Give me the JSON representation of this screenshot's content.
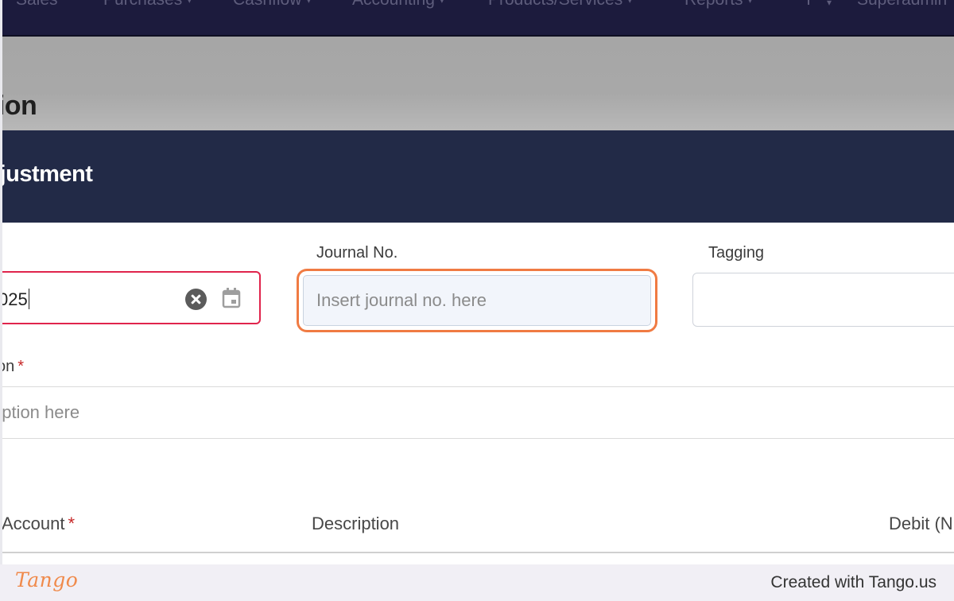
{
  "nav": {
    "items": [
      {
        "label": "Sales"
      },
      {
        "label": "Purchases"
      },
      {
        "label": "Cashflow"
      },
      {
        "label": "Accounting"
      },
      {
        "label": "Products/Services"
      },
      {
        "label": "Reports"
      },
      {
        "label": "Superadmin"
      }
    ]
  },
  "page": {
    "title": "tion"
  },
  "modal": {
    "title": "ljustment",
    "date": {
      "value": "025"
    },
    "journal": {
      "label": "Journal No.",
      "placeholder": "Insert journal no. here"
    },
    "tagging": {
      "label": "Tagging"
    },
    "description": {
      "label": "on",
      "required_mark": "*",
      "placeholder": "scription here"
    },
    "table": {
      "headers": [
        {
          "label": "Account",
          "required_mark": "*"
        },
        {
          "label": "Description"
        },
        {
          "label": "Debit (N"
        }
      ]
    }
  },
  "footer": {
    "logo_text": "Tango",
    "credit": "Created with Tango.us"
  },
  "colors": {
    "nav_bg": "#1c1b3d",
    "modal_header": "#222a47",
    "highlight": "#f07b43",
    "error_border": "#e0244c",
    "required": "#c62828"
  }
}
